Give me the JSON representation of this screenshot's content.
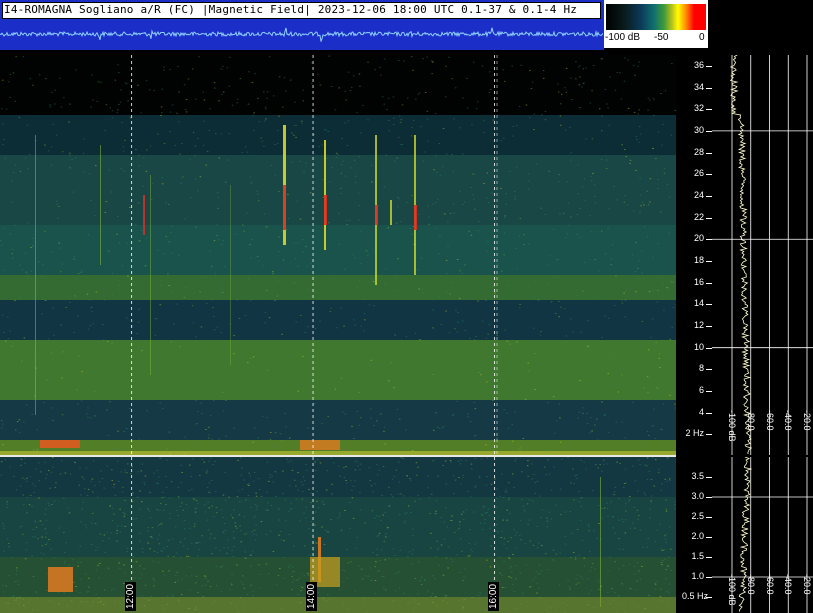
{
  "header": {
    "title": "I4-ROMAGNA  Sogliano a/R (FC) |Magnetic Field| 2023-12-06 18:00 UTC 0.1-37 & 0.1-4 Hz"
  },
  "color_scale": {
    "labels": [
      "-100 dB",
      "-50",
      "0"
    ]
  },
  "colors": {
    "waveform_bg": "#1b2ec8",
    "waveform_trace": "#8fd0ff",
    "spectrogram_bg": "#0a1a1a",
    "grid": "#ffffff",
    "right_panel_bg": "#000000",
    "trace": "#ffffcc"
  },
  "chart_data": [
    {
      "type": "heatmap",
      "name_hint": "upper spectrogram 0.1-37 Hz",
      "y_unit": "Hz",
      "ylim": [
        0.1,
        37
      ],
      "y_ticks": [
        "36",
        "34",
        "32",
        "30",
        "28",
        "26",
        "24",
        "22",
        "20",
        "18",
        "16",
        "14",
        "12",
        "10",
        "8",
        "6",
        "4",
        "2 Hz"
      ],
      "y_tick_values": [
        36,
        34,
        32,
        30,
        28,
        26,
        24,
        22,
        20,
        18,
        16,
        14,
        12,
        10,
        8,
        6,
        4,
        2
      ],
      "x_ticks": [
        "12:00",
        "14:00",
        "16:00"
      ],
      "x_tick_values_hours": [
        12,
        14,
        16
      ],
      "xlim_hours": [
        10.55,
        18.0
      ],
      "grid": true
    },
    {
      "type": "heatmap",
      "name_hint": "lower spectrogram 0.1-4 Hz",
      "y_unit": "Hz",
      "ylim": [
        0.1,
        4
      ],
      "y_ticks": [
        "3.5",
        "3.0",
        "2.5",
        "2.0",
        "1.5",
        "1.0",
        "0.5 Hz"
      ],
      "y_tick_values": [
        3.5,
        3.0,
        2.5,
        2.0,
        1.5,
        1.0,
        0.5
      ],
      "x_ticks": [
        "12:00",
        "14:00",
        "16:00"
      ],
      "x_tick_values_hours": [
        12,
        14,
        16
      ],
      "xlim_hours": [
        10.55,
        18.0
      ],
      "grid": true
    },
    {
      "type": "line",
      "name_hint": "upper power spectrum",
      "x_ticks": [
        "-100 dB",
        "-80.0",
        "-60.0",
        "-40.0",
        "-20.0"
      ],
      "x_tick_values": [
        -100,
        -80,
        -60,
        -40,
        -20
      ],
      "grid": true
    },
    {
      "type": "line",
      "name_hint": "lower power spectrum",
      "x_ticks": [
        "-100 dB",
        "-80.0",
        "-60.0",
        "-40.0",
        "-20.0"
      ],
      "x_tick_values": [
        -100,
        -80,
        -60,
        -40,
        -20
      ],
      "grid": true
    }
  ]
}
